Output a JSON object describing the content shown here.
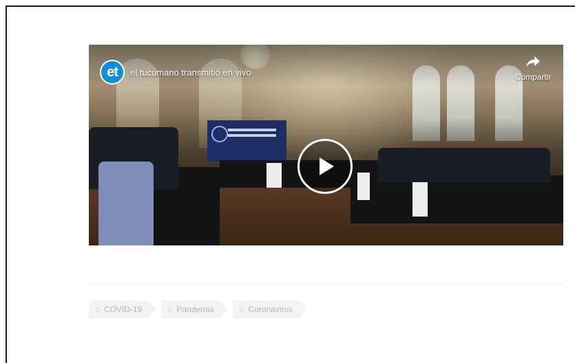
{
  "video": {
    "channel_logo": "et",
    "title": "el tucumano transmitió en vivo",
    "share_label": "Compartir",
    "play_icon": "play-icon",
    "share_icon": "share-arrow-icon"
  },
  "tags": [
    {
      "label": "COVID-19"
    },
    {
      "label": "Pandemia"
    },
    {
      "label": "Coronavirus"
    }
  ],
  "colors": {
    "logo": "#0e8fd8",
    "tag_bg": "#f3f3f3",
    "tag_text": "#b5b5b5"
  }
}
